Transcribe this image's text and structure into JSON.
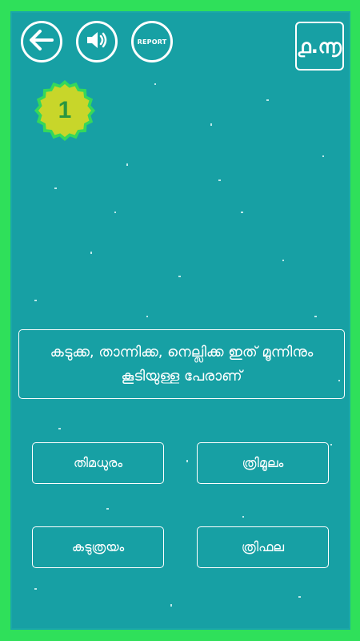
{
  "header": {
    "back_icon": "arrow-left-icon",
    "sound_icon": "speaker-icon",
    "report_label": "REPORT",
    "timer": "൧.൬"
  },
  "question_number": "1",
  "question_text": "കടുക്ക, താന്നിക്ക, നെല്ലിക്ക ഇത് മൂന്നിനും കൂടിയുള്ള പേരാണ്",
  "options": [
    "തിമധുരം",
    "ത്രിമൂലം",
    "കടുത്രയം",
    "ത്രിഫല"
  ],
  "colors": {
    "border_green": "#2fe05a",
    "board_teal": "#17a0a4",
    "badge_yellow": "#c8d62a",
    "badge_number": "#2a9640"
  }
}
